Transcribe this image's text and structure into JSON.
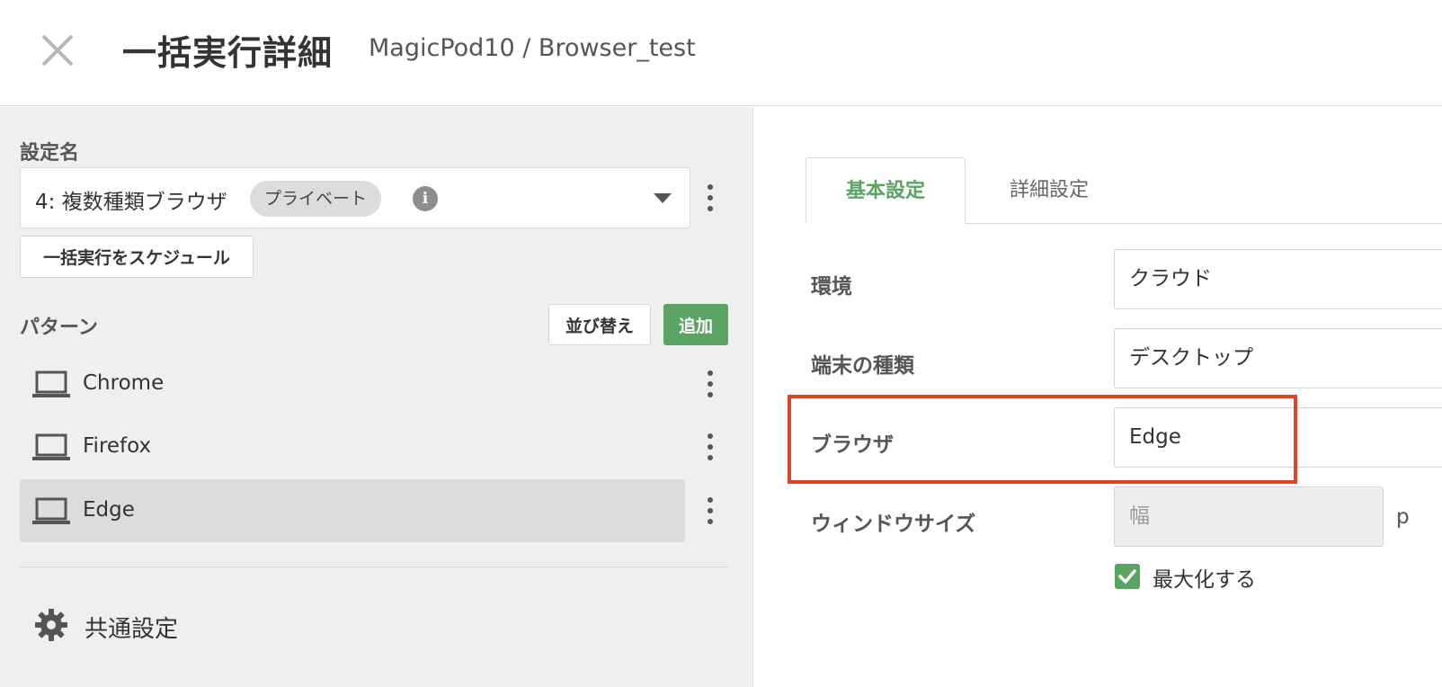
{
  "header": {
    "title": "一括実行詳細",
    "breadcrumb": "MagicPod10 / Browser_test"
  },
  "sidebar": {
    "config_label": "設定名",
    "config_value": "4: 複数種類ブラウザ",
    "config_badge": "プライベート",
    "info_glyph": "i",
    "schedule_button": "一括実行をスケジュール",
    "patterns_label": "パターン",
    "sort_button": "並び替え",
    "add_button": "追加",
    "patterns": [
      {
        "label": "Chrome",
        "selected": false
      },
      {
        "label": "Firefox",
        "selected": false
      },
      {
        "label": "Edge",
        "selected": true
      }
    ],
    "common_settings": "共通設定"
  },
  "main": {
    "tabs": [
      {
        "label": "基本設定",
        "active": true
      },
      {
        "label": "詳細設定",
        "active": false
      }
    ],
    "form": {
      "environment_label": "環境",
      "environment_value": "クラウド",
      "device_type_label": "端末の種類",
      "device_type_value": "デスクトップ",
      "browser_label": "ブラウザ",
      "browser_value": "Edge",
      "window_size_label": "ウィンドウサイズ",
      "width_placeholder": "幅",
      "unit_partial": "p",
      "maximize_label": "最大化する",
      "maximize_checked": true
    }
  },
  "colors": {
    "accent_green": "#5aa363",
    "highlight_red": "#e3402a"
  }
}
